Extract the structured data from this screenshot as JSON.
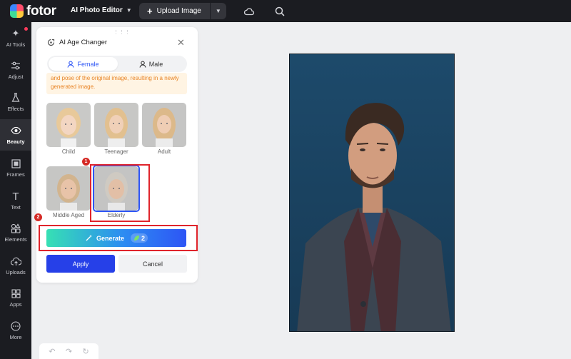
{
  "app": {
    "name": "fotor",
    "menu_label": "AI Photo Editor",
    "upload_label": "Upload Image"
  },
  "rail": {
    "items": [
      {
        "id": "ai-tools",
        "label": "AI Tools",
        "icon": "magic-wand-icon"
      },
      {
        "id": "adjust",
        "label": "Adjust",
        "icon": "sliders-icon"
      },
      {
        "id": "effects",
        "label": "Effects",
        "icon": "flask-icon"
      },
      {
        "id": "beauty",
        "label": "Beauty",
        "icon": "eye-icon",
        "active": true
      },
      {
        "id": "frames",
        "label": "Frames",
        "icon": "frame-icon"
      },
      {
        "id": "text",
        "label": "Text",
        "icon": "text-icon"
      },
      {
        "id": "elements",
        "label": "Elements",
        "icon": "shapes-icon"
      },
      {
        "id": "uploads",
        "label": "Uploads",
        "icon": "cloud-upload-icon"
      },
      {
        "id": "apps",
        "label": "Apps",
        "icon": "apps-icon"
      },
      {
        "id": "more",
        "label": "More",
        "icon": "more-icon"
      }
    ]
  },
  "panel": {
    "title": "AI Age Changer",
    "tabs": {
      "female": "Female",
      "male": "Male"
    },
    "notice": "and pose of the original image, resulting in a newly generated image.",
    "ages": [
      {
        "label": "Child"
      },
      {
        "label": "Teenager"
      },
      {
        "label": "Adult"
      },
      {
        "label": "Middle Aged"
      },
      {
        "label": "Elderly",
        "selected": true
      }
    ],
    "generate_label": "Generate",
    "credits": "2",
    "apply_label": "Apply",
    "cancel_label": "Cancel"
  },
  "annotations": {
    "step1": "1",
    "step2": "2"
  },
  "colors": {
    "accent": "#2d55f5",
    "topbar": "#1b1c21",
    "annotation": "#e0242b",
    "notice_text": "#e88425"
  }
}
